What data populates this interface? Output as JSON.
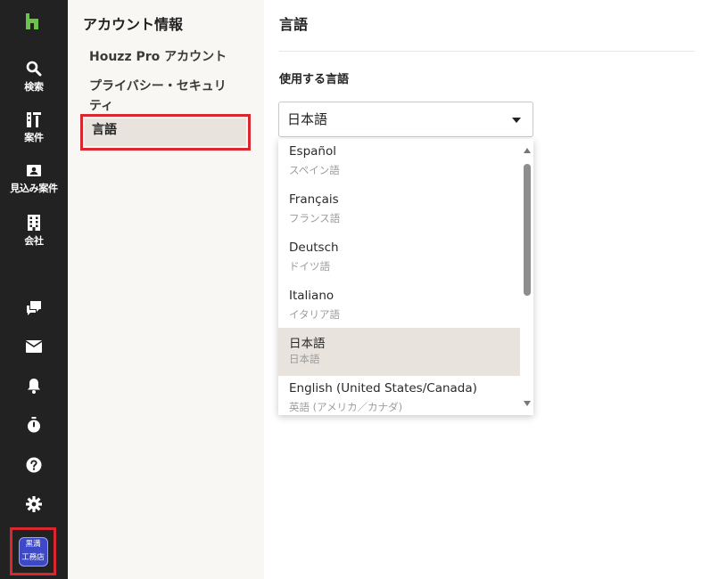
{
  "rail": {
    "items": [
      {
        "label": "検索",
        "icon": "search-icon"
      },
      {
        "label": "案件",
        "icon": "projects-icon"
      },
      {
        "label": "見込み案件",
        "icon": "leads-icon"
      },
      {
        "label": "会社",
        "icon": "company-icon"
      }
    ],
    "lower_icons": [
      "chat-icon",
      "mail-icon",
      "bell-icon",
      "timer-icon",
      "help-icon",
      "gear-icon"
    ],
    "avatar": {
      "line1": "黒満",
      "line2": "工務店"
    }
  },
  "subnav": {
    "title": "アカウント情報",
    "items": [
      {
        "label": "Houzz Pro アカウント"
      },
      {
        "label": "プライバシー・セキュリティ"
      },
      {
        "label": "言語"
      }
    ]
  },
  "main": {
    "title": "言語",
    "field_label": "使用する言語",
    "selected_value": "日本語",
    "options": [
      {
        "name": "Español",
        "sub": "スペイン語"
      },
      {
        "name": "Français",
        "sub": "フランス語"
      },
      {
        "name": "Deutsch",
        "sub": "ドイツ語"
      },
      {
        "name": "Italiano",
        "sub": "イタリア語"
      },
      {
        "name": "日本語",
        "sub": "日本語"
      },
      {
        "name": "English (United States/Canada)",
        "sub": "英語 (アメリカ／カナダ)"
      }
    ],
    "selected_index": 4
  },
  "colors": {
    "rail_bg": "#222222",
    "brand_green": "#6cc24a",
    "highlight_red": "#d9262f",
    "selected_bg": "#e8e4dd"
  }
}
